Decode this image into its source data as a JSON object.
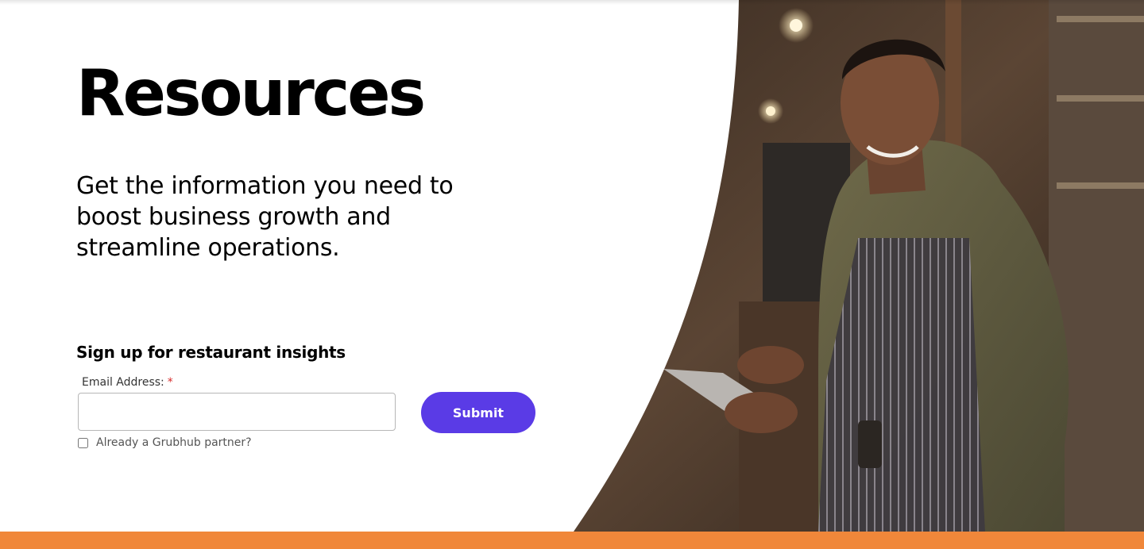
{
  "hero": {
    "title": "Resources",
    "subtitle": "Get the information you need to boost business growth and streamline operations."
  },
  "signup": {
    "heading": "Sign up for restaurant insights",
    "email_label": "Email Address:",
    "required_marker": "*",
    "email_value": "",
    "email_placeholder": "",
    "submit_label": "Submit",
    "partner_checkbox_label": "Already a Grubhub partner?",
    "partner_checked": false
  },
  "colors": {
    "accent_purple": "#5a3be6",
    "footer_orange": "#f0873a",
    "required_red": "#d62b2b"
  },
  "image": {
    "subject": "smiling restaurant worker in apron using tablet"
  }
}
